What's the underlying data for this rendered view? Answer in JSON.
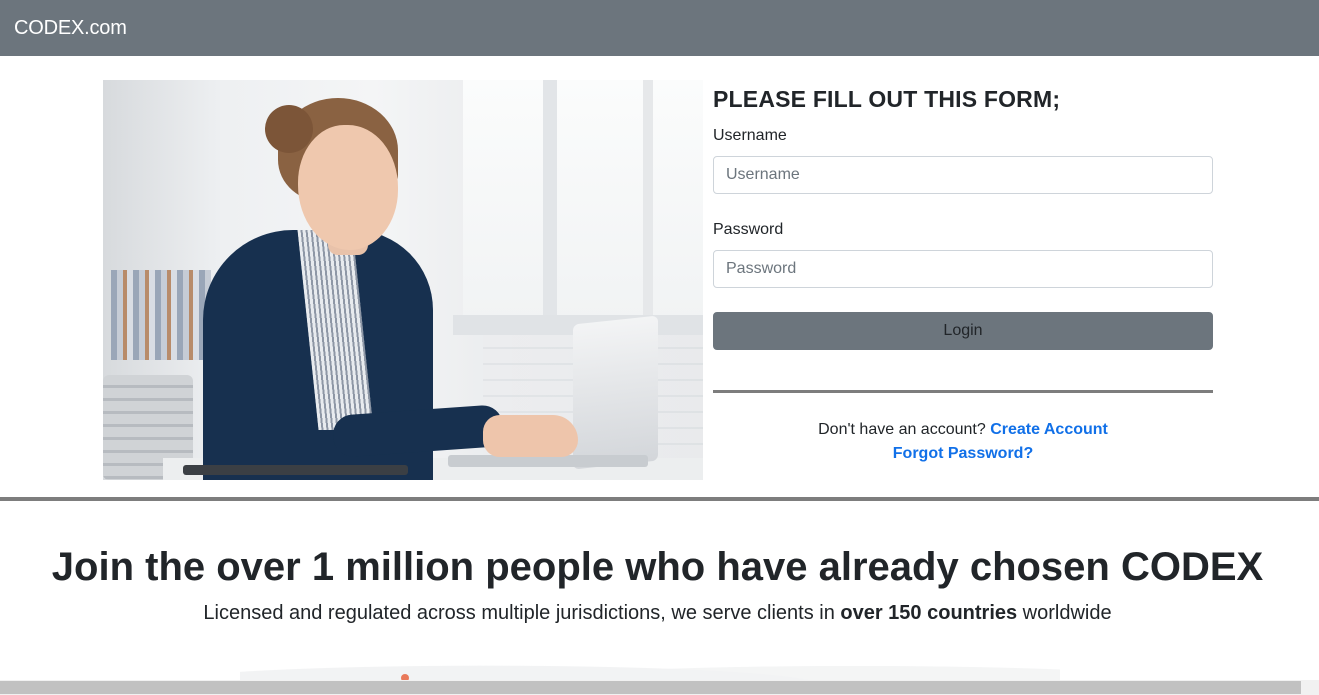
{
  "navbar": {
    "brand": "CODEX.com"
  },
  "hero_image": {
    "alt": "Woman working on a laptop at a desk"
  },
  "form": {
    "title": "PLEASE FILL OUT THIS FORM;",
    "username_label": "Username",
    "username_placeholder": "Username",
    "username_value": "",
    "password_label": "Password",
    "password_placeholder": "Password",
    "password_value": "",
    "login_label": "Login",
    "signup_prompt": "Don't have an account?",
    "create_account_label": "Create Account",
    "forgot_password_label": "Forgot Password?"
  },
  "promo": {
    "headline_pre": "Join the ",
    "headline_bold": "over 1 million",
    "headline_post": " people who have already chosen CODEX",
    "sub_pre": "Licensed and regulated across multiple jurisdictions, we serve clients in ",
    "sub_bold": "over 150 countries",
    "sub_post": " worldwide"
  },
  "colors": {
    "navbar": "#6c757d",
    "button": "#6c757d",
    "link": "#1170e8",
    "divider": "#7d7d7d"
  }
}
